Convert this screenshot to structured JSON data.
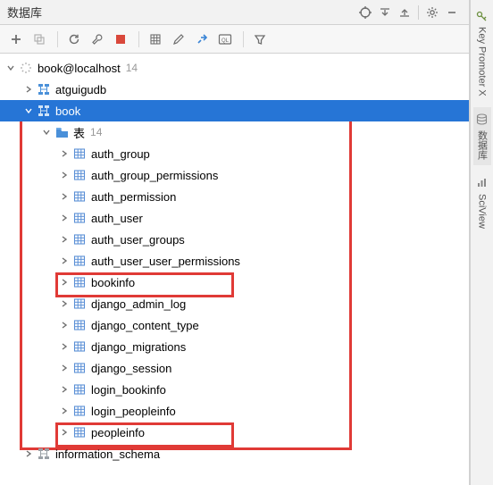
{
  "panel": {
    "title": "数据库"
  },
  "tree": {
    "root": {
      "label": "book@localhost",
      "count": "14"
    },
    "db1": {
      "label": "atguigudb"
    },
    "db2": {
      "label": "book"
    },
    "tables_folder": {
      "label": "表",
      "count": "14"
    },
    "tables": [
      "auth_group",
      "auth_group_permissions",
      "auth_permission",
      "auth_user",
      "auth_user_groups",
      "auth_user_user_permissions",
      "bookinfo",
      "django_admin_log",
      "django_content_type",
      "django_migrations",
      "django_session",
      "login_bookinfo",
      "login_peopleinfo",
      "peopleinfo"
    ],
    "db3": {
      "label": "information_schema"
    }
  },
  "side": {
    "tab1": "Key Promoter X",
    "tab2": "数据库",
    "tab3": "SciView"
  }
}
